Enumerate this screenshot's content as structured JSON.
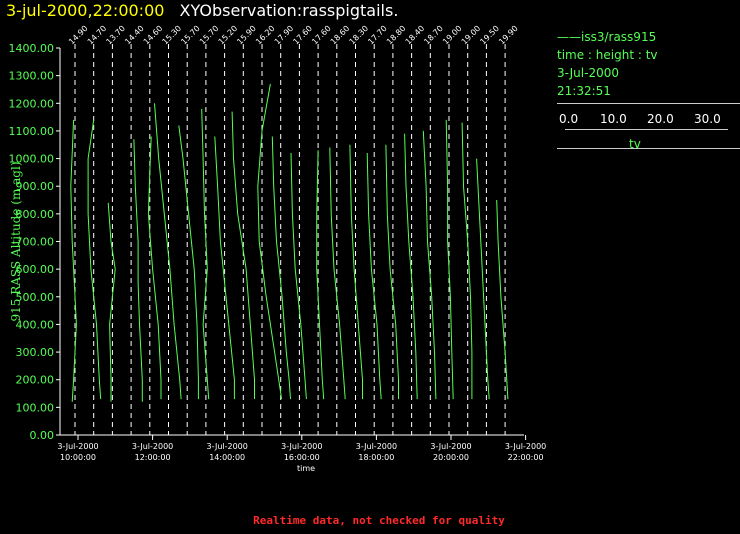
{
  "header": {
    "time": "3-jul-2000,22:00:00",
    "name": "XYObservation:rasspigtails."
  },
  "legend": {
    "series": "iss3/rass915",
    "axes": "time : height : tv",
    "date": "3-Jul-2000",
    "clock": "21:32:51",
    "scale_ticks": [
      "0.0",
      "10.0",
      "20.0",
      "30.0"
    ],
    "scale_unit": "tv"
  },
  "footer": "Realtime data, not checked for quality",
  "colors": {
    "curve": "#55ff55",
    "background": "#000000",
    "axis": "#ffffff",
    "title_time": "#ffff00",
    "footer": "#ff2a2a"
  },
  "chart_data": {
    "type": "line",
    "ylabel": "915 RASS Altitude (m agl)",
    "xlabel": "time",
    "ylim": [
      0,
      1400
    ],
    "y_ticks": [
      "0.00",
      "100.00",
      "200.00",
      "300.00",
      "400.00",
      "500.00",
      "600.00",
      "700.00",
      "800.00",
      "900.00",
      "1000.00",
      "1100.00",
      "1200.00",
      "1300.00",
      "1400.00"
    ],
    "x_ticks": [
      {
        "date": "3-Jul-2000",
        "time": "10:00:00"
      },
      {
        "date": "3-Jul-2000",
        "time": "12:00:00"
      },
      {
        "date": "3-Jul-2000",
        "time": "14:00:00"
      },
      {
        "date": "3-Jul-2000",
        "time": "16:00:00"
      },
      {
        "date": "3-Jul-2000",
        "time": "18:00:00"
      },
      {
        "date": "3-Jul-2000",
        "time": "20:00:00"
      },
      {
        "date": "3-Jul-2000",
        "time": "22:00:00"
      }
    ],
    "profiles": [
      {
        "base": "14.90",
        "points": [
          [
            1140,
            -1
          ],
          [
            900,
            -3
          ],
          [
            700,
            -2
          ],
          [
            400,
            1
          ],
          [
            200,
            -1
          ],
          [
            120,
            -2
          ]
        ]
      },
      {
        "base": "14.70",
        "points": [
          [
            1140,
            0
          ],
          [
            1000,
            -4
          ],
          [
            800,
            -4
          ],
          [
            600,
            -2
          ],
          [
            400,
            2
          ],
          [
            200,
            4
          ],
          [
            130,
            5
          ]
        ]
      },
      {
        "base": "13.70",
        "points": [
          [
            840,
            -3
          ],
          [
            700,
            -1
          ],
          [
            600,
            2
          ],
          [
            500,
            0
          ],
          [
            400,
            -2
          ],
          [
            200,
            -1
          ],
          [
            120,
            -1
          ]
        ]
      },
      {
        "base": "14.40",
        "points": [
          [
            1070,
            2
          ],
          [
            900,
            3
          ],
          [
            700,
            5
          ],
          [
            550,
            5
          ],
          [
            400,
            6
          ],
          [
            200,
            8
          ],
          [
            120,
            8
          ]
        ]
      },
      {
        "base": "14.60",
        "points": [
          [
            1080,
            1
          ],
          [
            950,
            0
          ],
          [
            800,
            -1
          ],
          [
            600,
            2
          ],
          [
            400,
            6
          ],
          [
            200,
            8
          ],
          [
            130,
            8
          ]
        ]
      },
      {
        "base": "15.30",
        "points": [
          [
            1200,
            -10
          ],
          [
            1000,
            -7
          ],
          [
            800,
            -3
          ],
          [
            600,
            1
          ],
          [
            400,
            4
          ],
          [
            200,
            8
          ],
          [
            130,
            9
          ]
        ]
      },
      {
        "base": "15.70",
        "points": [
          [
            1120,
            -6
          ],
          [
            1000,
            -3
          ],
          [
            800,
            1
          ],
          [
            600,
            5
          ],
          [
            400,
            7
          ],
          [
            200,
            8
          ],
          [
            130,
            8
          ]
        ]
      },
      {
        "base": "15.70",
        "points": [
          [
            1180,
            -3
          ],
          [
            1000,
            -2
          ],
          [
            800,
            -1
          ],
          [
            600,
            1
          ],
          [
            400,
            -2
          ],
          [
            200,
            1
          ],
          [
            130,
            2
          ]
        ]
      },
      {
        "base": "15.20",
        "points": [
          [
            1080,
            -7
          ],
          [
            900,
            -5
          ],
          [
            700,
            -3
          ],
          [
            500,
            1
          ],
          [
            300,
            5
          ],
          [
            200,
            7
          ],
          [
            130,
            7
          ]
        ]
      },
      {
        "base": "15.90",
        "points": [
          [
            1170,
            -8
          ],
          [
            1000,
            -7
          ],
          [
            800,
            -4
          ],
          [
            600,
            2
          ],
          [
            400,
            5
          ],
          [
            200,
            8
          ],
          [
            130,
            8
          ]
        ]
      },
      {
        "base": "16.20",
        "points": [
          [
            1270,
            6
          ],
          [
            1100,
            0
          ],
          [
            900,
            -3
          ],
          [
            700,
            -2
          ],
          [
            500,
            3
          ],
          [
            300,
            9
          ],
          [
            130,
            14
          ]
        ]
      },
      {
        "base": "17.90",
        "points": [
          [
            1080,
            -6
          ],
          [
            900,
            -5
          ],
          [
            700,
            -3
          ],
          [
            500,
            1
          ],
          [
            300,
            4
          ],
          [
            200,
            6
          ],
          [
            130,
            7
          ]
        ]
      },
      {
        "base": "17.60",
        "points": [
          [
            1020,
            -6
          ],
          [
            800,
            -5
          ],
          [
            600,
            -3
          ],
          [
            400,
            1
          ],
          [
            200,
            4
          ],
          [
            130,
            5
          ]
        ]
      },
      {
        "base": "17.60",
        "points": [
          [
            1030,
            0
          ],
          [
            800,
            -1
          ],
          [
            600,
            -1
          ],
          [
            400,
            1
          ],
          [
            200,
            3
          ],
          [
            130,
            4
          ]
        ]
      },
      {
        "base": "18.60",
        "points": [
          [
            1040,
            -5
          ],
          [
            800,
            -4
          ],
          [
            600,
            -2
          ],
          [
            400,
            2
          ],
          [
            200,
            5
          ],
          [
            130,
            6
          ]
        ]
      },
      {
        "base": "18.30",
        "points": [
          [
            1050,
            -4
          ],
          [
            800,
            -3
          ],
          [
            600,
            -1
          ],
          [
            400,
            2
          ],
          [
            200,
            5
          ],
          [
            130,
            5
          ]
        ]
      },
      {
        "base": "17.70",
        "points": [
          [
            1020,
            -5
          ],
          [
            800,
            -4
          ],
          [
            600,
            -2
          ],
          [
            400,
            2
          ],
          [
            200,
            4
          ],
          [
            130,
            5
          ]
        ]
      },
      {
        "base": "18.80",
        "points": [
          [
            1050,
            -5
          ],
          [
            800,
            -4
          ],
          [
            600,
            -2
          ],
          [
            400,
            2
          ],
          [
            200,
            4
          ],
          [
            130,
            4
          ]
        ]
      },
      {
        "base": "18.40",
        "points": [
          [
            1090,
            -5
          ],
          [
            900,
            -4
          ],
          [
            700,
            -2
          ],
          [
            500,
            1
          ],
          [
            300,
            3
          ],
          [
            130,
            4
          ]
        ]
      },
      {
        "base": "18.70",
        "points": [
          [
            1100,
            -5
          ],
          [
            900,
            -3
          ],
          [
            700,
            -2
          ],
          [
            500,
            1
          ],
          [
            300,
            3
          ],
          [
            130,
            4
          ]
        ]
      },
      {
        "base": "19.00",
        "points": [
          [
            1140,
            -2
          ],
          [
            900,
            -1
          ],
          [
            700,
            -1
          ],
          [
            500,
            1
          ],
          [
            300,
            2
          ],
          [
            130,
            3
          ]
        ]
      },
      {
        "base": "19.00",
        "points": [
          [
            1130,
            -4
          ],
          [
            900,
            -3
          ],
          [
            700,
            0
          ],
          [
            500,
            2
          ],
          [
            300,
            3
          ],
          [
            130,
            3
          ]
        ]
      },
      {
        "base": "19.50",
        "points": [
          [
            1000,
            -7
          ],
          [
            800,
            -5
          ],
          [
            600,
            -3
          ],
          [
            400,
            -1
          ],
          [
            200,
            1
          ],
          [
            130,
            2
          ]
        ]
      },
      {
        "base": "19.90",
        "points": [
          [
            850,
            -6
          ],
          [
            700,
            -5
          ],
          [
            500,
            -3
          ],
          [
            300,
            0
          ],
          [
            130,
            2
          ]
        ]
      }
    ]
  }
}
